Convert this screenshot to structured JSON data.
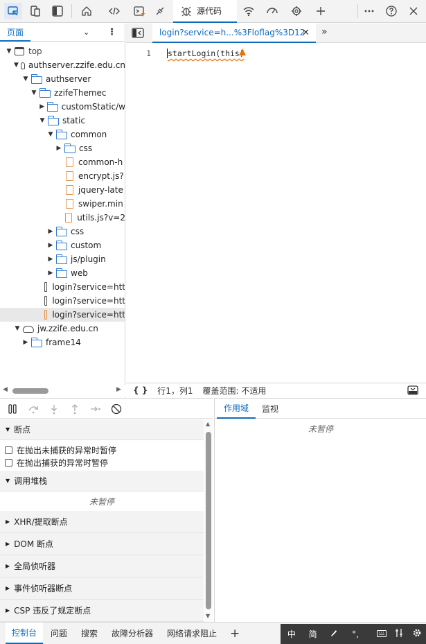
{
  "toolbar": {
    "sources_tab_label": "源代码"
  },
  "navigator": {
    "page_tab": "页面",
    "tree": [
      {
        "label": "top",
        "type": "frame",
        "depth": 0,
        "expanded": true
      },
      {
        "label": "authserver.zzife.edu.cn",
        "type": "domain",
        "depth": 1,
        "expanded": true
      },
      {
        "label": "authserver",
        "type": "folder",
        "depth": 2,
        "expanded": true
      },
      {
        "label": "zzifeThemec",
        "type": "folder",
        "depth": 3,
        "expanded": true
      },
      {
        "label": "customStatic/w",
        "type": "folder",
        "depth": 4,
        "expanded": false
      },
      {
        "label": "static",
        "type": "folder",
        "depth": 4,
        "expanded": true
      },
      {
        "label": "common",
        "type": "folder",
        "depth": 5,
        "expanded": true
      },
      {
        "label": "css",
        "type": "folder",
        "depth": 6,
        "expanded": false
      },
      {
        "label": "common-h",
        "type": "file",
        "depth": 6
      },
      {
        "label": "encrypt.js?",
        "type": "file",
        "depth": 6
      },
      {
        "label": "jquery-late",
        "type": "file",
        "depth": 6
      },
      {
        "label": "swiper.min",
        "type": "file",
        "depth": 6
      },
      {
        "label": "utils.js?v=2",
        "type": "file",
        "depth": 6
      },
      {
        "label": "css",
        "type": "folder",
        "depth": 5,
        "expanded": false
      },
      {
        "label": "custom",
        "type": "folder",
        "depth": 5,
        "expanded": false
      },
      {
        "label": "js/plugin",
        "type": "folder",
        "depth": 5,
        "expanded": false
      },
      {
        "label": "web",
        "type": "folder",
        "depth": 5,
        "expanded": false
      },
      {
        "label": "login?service=htt",
        "type": "doc",
        "depth": 4
      },
      {
        "label": "login?service=htt",
        "type": "doc",
        "depth": 4
      },
      {
        "label": "login?service=htt",
        "type": "doc-active",
        "depth": 4,
        "selected": true
      },
      {
        "label": "jw.zzife.edu.cn",
        "type": "domain",
        "depth": 1,
        "expanded": true
      },
      {
        "label": "frame14",
        "type": "folder",
        "depth": 2,
        "expanded": false
      }
    ]
  },
  "editor": {
    "file_tab": "login?service=h...%3Floflag%3D12",
    "line_number": "1",
    "code": "startLogin(this)"
  },
  "status": {
    "braces": "{ }",
    "position": "行1，列1",
    "coverage": "覆盖范围: 不适用"
  },
  "debugger": {
    "sections": {
      "breakpoints": "断点",
      "call_stack": "调用堆栈",
      "xhr": "XHR/提取断点",
      "dom": "DOM 断点",
      "global_listeners": "全局侦听器",
      "event_listeners": "事件侦听器断点",
      "csp": "CSP 违反了规定断点"
    },
    "pause_uncaught": "在抛出未捕获的异常时暂停",
    "pause_caught": "在抛出捕获的异常时暂停",
    "not_paused": "未暂停"
  },
  "scope": {
    "tab_scope": "作用域",
    "tab_watch": "监视",
    "not_paused": "未暂停"
  },
  "drawer": {
    "tabs": [
      "控制台",
      "问题",
      "搜索",
      "故障分析器",
      "网络请求阻止"
    ]
  },
  "ime": {
    "items": [
      "中",
      "简"
    ]
  },
  "colors": {
    "accent": "#0f6cbd",
    "warning": "#e8710a"
  }
}
